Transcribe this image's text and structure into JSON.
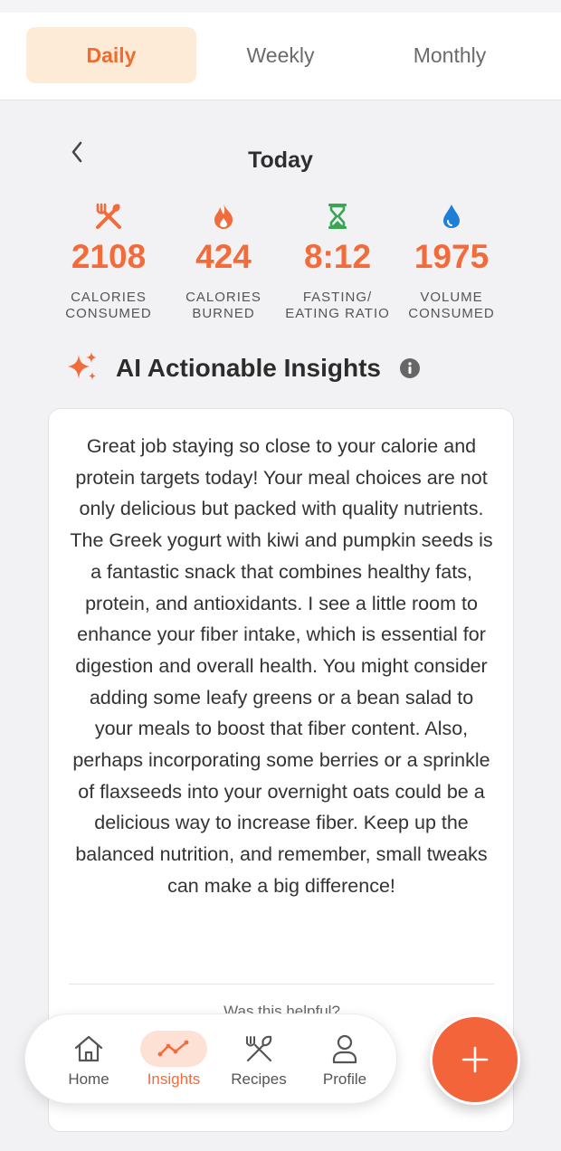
{
  "tabs": [
    {
      "label": "Daily",
      "active": true
    },
    {
      "label": "Weekly",
      "active": false
    },
    {
      "label": "Monthly",
      "active": false
    }
  ],
  "date_title": "Today",
  "stats": [
    {
      "icon": "fork-knife-icon",
      "value": "2108",
      "label_line1": "CALORIES",
      "label_line2": "CONSUMED"
    },
    {
      "icon": "flame-icon",
      "value": "424",
      "label_line1": "CALORIES",
      "label_line2": "BURNED"
    },
    {
      "icon": "hourglass-icon",
      "value": "8:12",
      "label_line1": "FASTING/",
      "label_line2": "EATING RATIO"
    },
    {
      "icon": "water-drop-icon",
      "value": "1975",
      "label_line1": "VOLUME",
      "label_line2": "CONSUMED"
    }
  ],
  "insights": {
    "title": "AI Actionable Insights",
    "text": "Great job staying so close to your calorie and protein targets today! Your meal choices are not only delicious but packed with quality nutrients. The Greek yogurt with kiwi and pumpkin seeds is a fantastic snack that combines healthy fats, protein, and antioxidants. I see a little room to enhance your fiber intake, which is essential for digestion and overall health. You might consider adding some leafy greens or a bean salad to your meals to boost that fiber content. Also, perhaps incorporating some berries or a sprinkle of flaxseeds into your overnight oats could be a delicious way to increase fiber. Keep up the balanced nutrition, and remember, small tweaks can make a big difference!",
    "feedback_prompt": "Was this helpful?"
  },
  "nav": [
    {
      "label": "Home",
      "active": false
    },
    {
      "label": "Insights",
      "active": true
    },
    {
      "label": "Recipes",
      "active": false
    },
    {
      "label": "Profile",
      "active": false
    }
  ],
  "colors": {
    "accent": "#f26b3b",
    "active_tab_bg": "#fdebd8",
    "hourglass": "#3aa654",
    "water": "#1e7fd6"
  }
}
